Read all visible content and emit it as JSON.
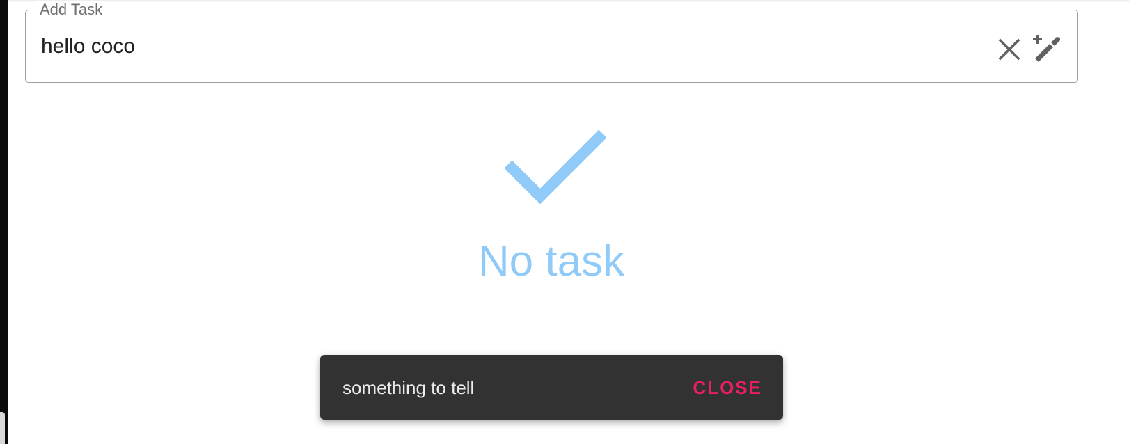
{
  "add_task": {
    "legend": "Add Task",
    "value": "hello coco",
    "clear_icon": "close-icon",
    "submit_icon": "auto-fix-wand-icon"
  },
  "empty_state": {
    "icon": "check-icon",
    "text": "No task",
    "color": "#90caf9"
  },
  "snackbar": {
    "message": "something to tell",
    "action_label": "CLOSE",
    "action_color": "#e91e63",
    "background": "#323232"
  }
}
